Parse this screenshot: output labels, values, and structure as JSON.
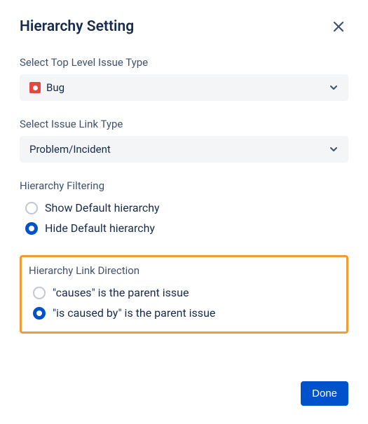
{
  "header": {
    "title": "Hierarchy Setting"
  },
  "topLevel": {
    "label": "Select Top Level Issue Type",
    "value": "Bug"
  },
  "linkType": {
    "label": "Select Issue Link Type",
    "value": "Problem/Incident"
  },
  "filtering": {
    "label": "Hierarchy Filtering",
    "options": [
      {
        "label": "Show Default hierarchy",
        "checked": false
      },
      {
        "label": "Hide Default hierarchy",
        "checked": true
      }
    ]
  },
  "linkDirection": {
    "label": "Hierarchy Link Direction",
    "options": [
      {
        "label": "\"causes\" is the parent issue",
        "checked": false
      },
      {
        "label": "\"is caused by\" is the parent issue",
        "checked": true
      }
    ]
  },
  "footer": {
    "done": "Done"
  }
}
